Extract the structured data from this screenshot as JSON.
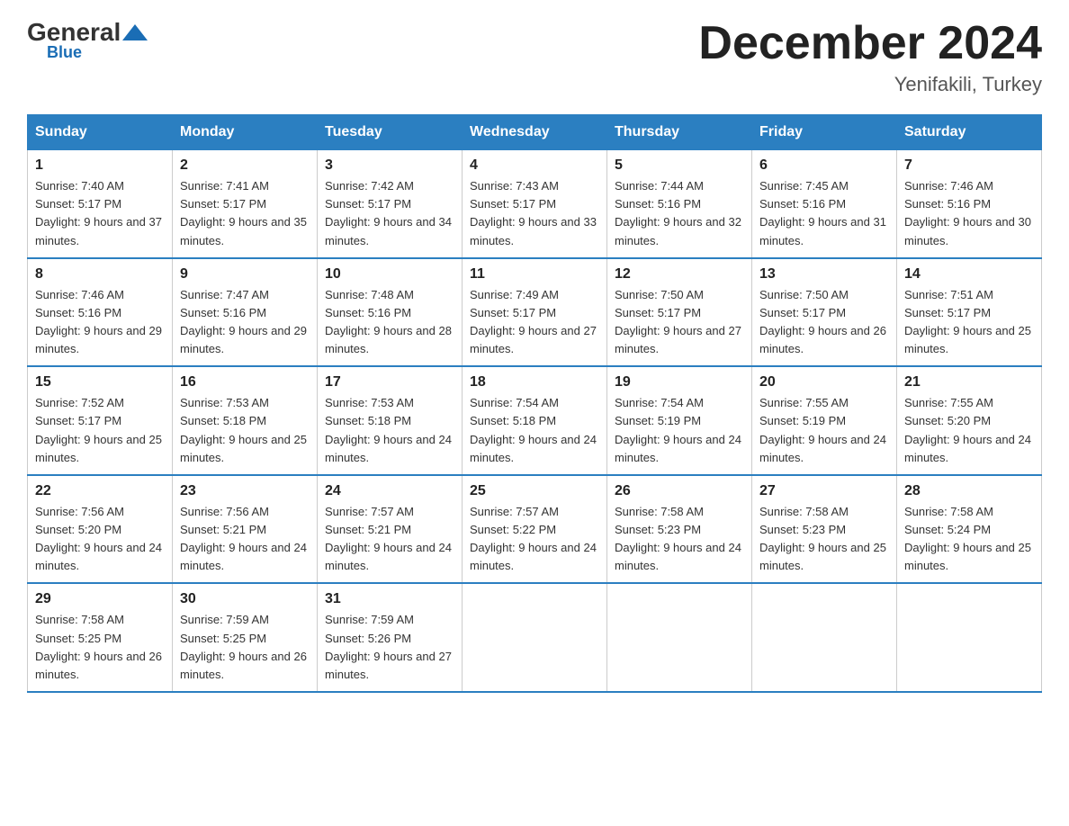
{
  "logo": {
    "general": "General",
    "blue": "Blue"
  },
  "header": {
    "month_title": "December 2024",
    "location": "Yenifakili, Turkey"
  },
  "days_of_week": [
    "Sunday",
    "Monday",
    "Tuesday",
    "Wednesday",
    "Thursday",
    "Friday",
    "Saturday"
  ],
  "weeks": [
    [
      {
        "day": "1",
        "sunrise": "7:40 AM",
        "sunset": "5:17 PM",
        "daylight": "9 hours and 37 minutes."
      },
      {
        "day": "2",
        "sunrise": "7:41 AM",
        "sunset": "5:17 PM",
        "daylight": "9 hours and 35 minutes."
      },
      {
        "day": "3",
        "sunrise": "7:42 AM",
        "sunset": "5:17 PM",
        "daylight": "9 hours and 34 minutes."
      },
      {
        "day": "4",
        "sunrise": "7:43 AM",
        "sunset": "5:17 PM",
        "daylight": "9 hours and 33 minutes."
      },
      {
        "day": "5",
        "sunrise": "7:44 AM",
        "sunset": "5:16 PM",
        "daylight": "9 hours and 32 minutes."
      },
      {
        "day": "6",
        "sunrise": "7:45 AM",
        "sunset": "5:16 PM",
        "daylight": "9 hours and 31 minutes."
      },
      {
        "day": "7",
        "sunrise": "7:46 AM",
        "sunset": "5:16 PM",
        "daylight": "9 hours and 30 minutes."
      }
    ],
    [
      {
        "day": "8",
        "sunrise": "7:46 AM",
        "sunset": "5:16 PM",
        "daylight": "9 hours and 29 minutes."
      },
      {
        "day": "9",
        "sunrise": "7:47 AM",
        "sunset": "5:16 PM",
        "daylight": "9 hours and 29 minutes."
      },
      {
        "day": "10",
        "sunrise": "7:48 AM",
        "sunset": "5:16 PM",
        "daylight": "9 hours and 28 minutes."
      },
      {
        "day": "11",
        "sunrise": "7:49 AM",
        "sunset": "5:17 PM",
        "daylight": "9 hours and 27 minutes."
      },
      {
        "day": "12",
        "sunrise": "7:50 AM",
        "sunset": "5:17 PM",
        "daylight": "9 hours and 27 minutes."
      },
      {
        "day": "13",
        "sunrise": "7:50 AM",
        "sunset": "5:17 PM",
        "daylight": "9 hours and 26 minutes."
      },
      {
        "day": "14",
        "sunrise": "7:51 AM",
        "sunset": "5:17 PM",
        "daylight": "9 hours and 25 minutes."
      }
    ],
    [
      {
        "day": "15",
        "sunrise": "7:52 AM",
        "sunset": "5:17 PM",
        "daylight": "9 hours and 25 minutes."
      },
      {
        "day": "16",
        "sunrise": "7:53 AM",
        "sunset": "5:18 PM",
        "daylight": "9 hours and 25 minutes."
      },
      {
        "day": "17",
        "sunrise": "7:53 AM",
        "sunset": "5:18 PM",
        "daylight": "9 hours and 24 minutes."
      },
      {
        "day": "18",
        "sunrise": "7:54 AM",
        "sunset": "5:18 PM",
        "daylight": "9 hours and 24 minutes."
      },
      {
        "day": "19",
        "sunrise": "7:54 AM",
        "sunset": "5:19 PM",
        "daylight": "9 hours and 24 minutes."
      },
      {
        "day": "20",
        "sunrise": "7:55 AM",
        "sunset": "5:19 PM",
        "daylight": "9 hours and 24 minutes."
      },
      {
        "day": "21",
        "sunrise": "7:55 AM",
        "sunset": "5:20 PM",
        "daylight": "9 hours and 24 minutes."
      }
    ],
    [
      {
        "day": "22",
        "sunrise": "7:56 AM",
        "sunset": "5:20 PM",
        "daylight": "9 hours and 24 minutes."
      },
      {
        "day": "23",
        "sunrise": "7:56 AM",
        "sunset": "5:21 PM",
        "daylight": "9 hours and 24 minutes."
      },
      {
        "day": "24",
        "sunrise": "7:57 AM",
        "sunset": "5:21 PM",
        "daylight": "9 hours and 24 minutes."
      },
      {
        "day": "25",
        "sunrise": "7:57 AM",
        "sunset": "5:22 PM",
        "daylight": "9 hours and 24 minutes."
      },
      {
        "day": "26",
        "sunrise": "7:58 AM",
        "sunset": "5:23 PM",
        "daylight": "9 hours and 24 minutes."
      },
      {
        "day": "27",
        "sunrise": "7:58 AM",
        "sunset": "5:23 PM",
        "daylight": "9 hours and 25 minutes."
      },
      {
        "day": "28",
        "sunrise": "7:58 AM",
        "sunset": "5:24 PM",
        "daylight": "9 hours and 25 minutes."
      }
    ],
    [
      {
        "day": "29",
        "sunrise": "7:58 AM",
        "sunset": "5:25 PM",
        "daylight": "9 hours and 26 minutes."
      },
      {
        "day": "30",
        "sunrise": "7:59 AM",
        "sunset": "5:25 PM",
        "daylight": "9 hours and 26 minutes."
      },
      {
        "day": "31",
        "sunrise": "7:59 AM",
        "sunset": "5:26 PM",
        "daylight": "9 hours and 27 minutes."
      },
      null,
      null,
      null,
      null
    ]
  ]
}
